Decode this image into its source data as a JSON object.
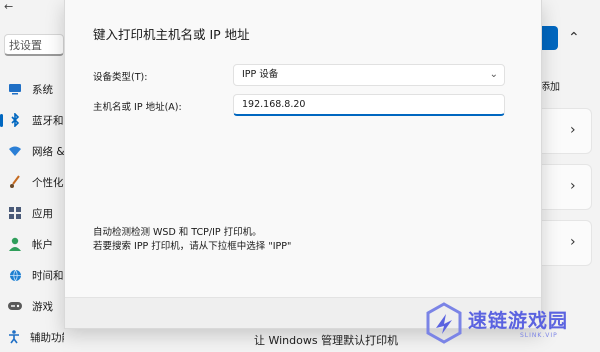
{
  "background": {
    "top_glyph": "←",
    "search_text": "设置",
    "search_text_full": "找设置",
    "nav_items": [
      {
        "label": "系统",
        "icon": "monitor-icon",
        "color": "#1f6fc5"
      },
      {
        "label": "蓝牙和",
        "icon": "bluetooth-icon",
        "color": "#0067c0"
      },
      {
        "label": "网络 &",
        "icon": "wifi-icon",
        "color": "#2b7fd6"
      },
      {
        "label": "个性化",
        "icon": "brush-icon",
        "color": "#c56a1f"
      },
      {
        "label": "应用",
        "icon": "apps-icon",
        "color": "#4a5a78"
      },
      {
        "label": "帐户",
        "icon": "account-icon",
        "color": "#2f9e5a"
      },
      {
        "label": "时间和",
        "icon": "globe-icon",
        "color": "#1e7fd0"
      },
      {
        "label": "游戏",
        "icon": "gamepad-icon",
        "color": "#5a5a5a"
      },
      {
        "label": "辅助功能",
        "icon": "accessibility-icon",
        "color": "#1f6fc5"
      }
    ],
    "add_text": "添加",
    "bottom_text": "让 Windows 管理默认打印机",
    "collapse_chevron": "⌃",
    "row_chevron": "›"
  },
  "dialog": {
    "title": "键入打印机主机名或 IP 地址",
    "device_type_label": "设备类型(T):",
    "device_type_value": "IPP 设备",
    "hostname_label": "主机名或 IP 地址(A):",
    "hostname_value": "192.168.8.20",
    "hint_line1": "自动检测检测 WSD 和 TCP/IP 打印机。",
    "hint_line2": "若要搜索 IPP 打印机，请从下拉框中选择 \"IPP\""
  },
  "watermark": {
    "text": "速链游戏园",
    "subtext": "SLINK.VIP",
    "color": "#5b63e0"
  }
}
